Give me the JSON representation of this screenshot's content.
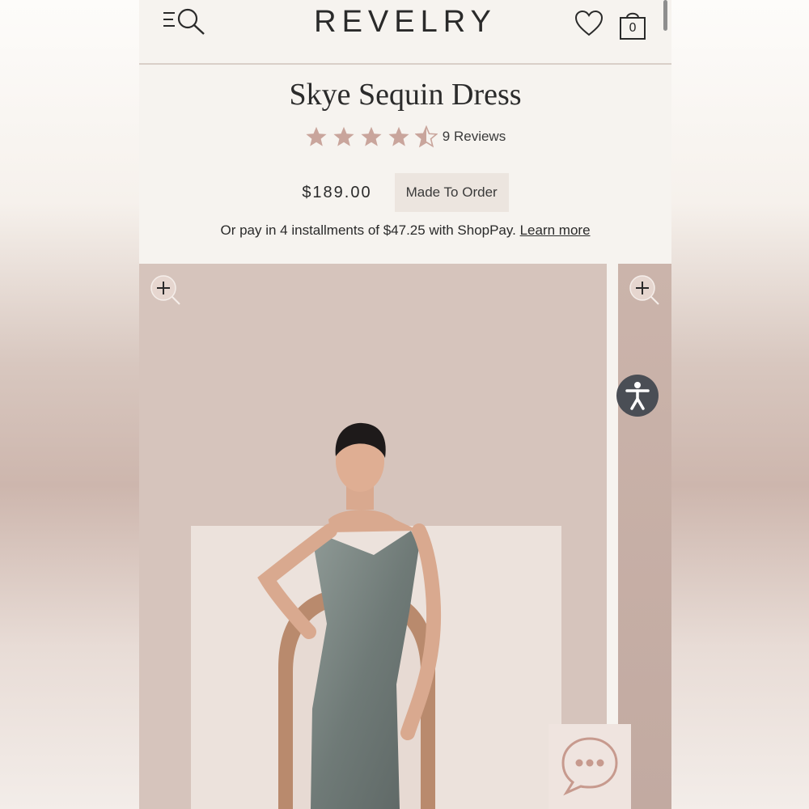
{
  "brand": "REVELRY",
  "header": {
    "cart_count": "0"
  },
  "product": {
    "title": "Skye Sequin Dress",
    "rating": 4.5,
    "rating_max": 5,
    "reviews_label": "9 Reviews",
    "price": "$189.00",
    "badge": "Made To Order",
    "installments_text": "Or pay in 4 installments of $47.25 with ShopPay.",
    "learn_more": "Learn more"
  },
  "colors": {
    "star": "#c9a59c",
    "accent_bg": "#ece5df",
    "accessibility_button": "#4a4e55"
  },
  "icons": [
    "menu-search-icon",
    "heart-icon",
    "cart-icon",
    "zoom-icon",
    "accessibility-icon",
    "chat-icon"
  ]
}
